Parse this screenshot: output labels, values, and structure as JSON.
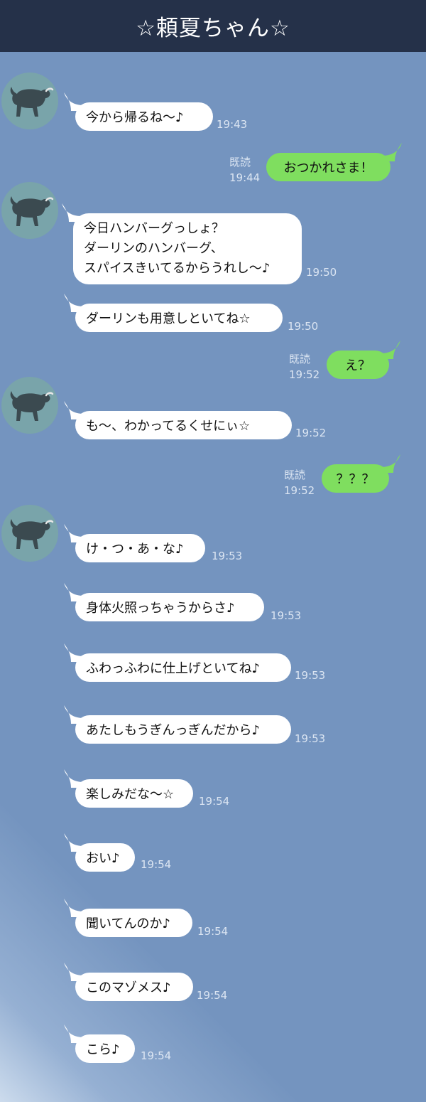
{
  "header": {
    "title": "☆頼夏ちゃん☆"
  },
  "colors": {
    "background": "#7494bf",
    "header": "#253149",
    "incoming_bubble": "#ffffff",
    "outgoing_bubble": "#7fde5f",
    "avatar": "#79a4aa"
  },
  "icons": {
    "avatar": "bull-icon"
  },
  "messages": [
    {
      "side": "in",
      "avatar": true,
      "lines": [
        "今から帰るね〜♪"
      ],
      "time": "19:43"
    },
    {
      "side": "out",
      "lines": [
        "おつかれさま！"
      ],
      "read": "既読",
      "time": "19:44"
    },
    {
      "side": "in",
      "avatar": true,
      "lines": [
        "今日ハンバーグっしょ？",
        "ダーリンのハンバーグ、",
        "スパイスきいてるからうれし〜♪"
      ],
      "time": "19:50"
    },
    {
      "side": "in",
      "lines": [
        "ダーリンも用意しといてね☆"
      ],
      "time": "19:50"
    },
    {
      "side": "out",
      "lines": [
        "え？"
      ],
      "read": "既読",
      "time": "19:52"
    },
    {
      "side": "in",
      "avatar": true,
      "lines": [
        "も〜、わかってるくせにぃ☆"
      ],
      "time": "19:52"
    },
    {
      "side": "out",
      "lines": [
        "？？？"
      ],
      "read": "既読",
      "time": "19:52"
    },
    {
      "side": "in",
      "avatar": true,
      "lines": [
        "け・つ・あ・な♪"
      ],
      "time": "19:53"
    },
    {
      "side": "in",
      "lines": [
        "身体火照っちゃうからさ♪"
      ],
      "time": "19:53"
    },
    {
      "side": "in",
      "lines": [
        "ふわっふわに仕上げといてね♪"
      ],
      "time": "19:53"
    },
    {
      "side": "in",
      "lines": [
        "あたしもうぎんっぎんだから♪"
      ],
      "time": "19:53"
    },
    {
      "side": "in",
      "lines": [
        "楽しみだな〜☆"
      ],
      "time": "19:54"
    },
    {
      "side": "in",
      "lines": [
        "おい♪"
      ],
      "time": "19:54"
    },
    {
      "side": "in",
      "lines": [
        "聞いてんのか♪"
      ],
      "time": "19:54"
    },
    {
      "side": "in",
      "lines": [
        "このマゾメス♪"
      ],
      "time": "19:54"
    },
    {
      "side": "in",
      "lines": [
        "こら♪"
      ],
      "time": "19:54"
    }
  ]
}
